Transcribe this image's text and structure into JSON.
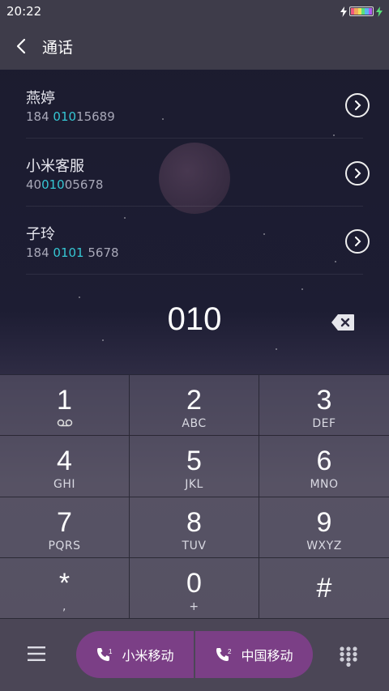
{
  "status_bar": {
    "time": "20:22"
  },
  "header": {
    "title": "通话"
  },
  "contacts": [
    {
      "name": "燕婷",
      "number_pre": "184 ",
      "number_hl": "010",
      "number_post": "15689"
    },
    {
      "name": "小米客服",
      "number_pre": "40",
      "number_hl": "010",
      "number_post": "05678"
    },
    {
      "name": "子玲",
      "number_pre": "184 ",
      "number_hl": "0101",
      "number_post": " 5678"
    }
  ],
  "dialed_number": "010",
  "keypad": [
    {
      "digit": "1",
      "letters": ""
    },
    {
      "digit": "2",
      "letters": "ABC"
    },
    {
      "digit": "3",
      "letters": "DEF"
    },
    {
      "digit": "4",
      "letters": "GHI"
    },
    {
      "digit": "5",
      "letters": "JKL"
    },
    {
      "digit": "6",
      "letters": "MNO"
    },
    {
      "digit": "7",
      "letters": "PQRS"
    },
    {
      "digit": "8",
      "letters": "TUV"
    },
    {
      "digit": "9",
      "letters": "WXYZ"
    },
    {
      "digit": "*",
      "letters": ","
    },
    {
      "digit": "0",
      "letters": "+"
    },
    {
      "digit": "#",
      "letters": ""
    }
  ],
  "call_buttons": [
    {
      "label": "小米移动",
      "sim": "1"
    },
    {
      "label": "中国移动",
      "sim": "2"
    }
  ],
  "colors": {
    "highlight": "#35c6d3",
    "call_button": "#7b3f86",
    "header_bg": "#3e3c4a"
  },
  "icons": [
    "back-icon",
    "chevron-right-icon",
    "backspace-icon",
    "voicemail-icon",
    "menu-icon",
    "phone-icon",
    "dialpad-icon",
    "charging-icon",
    "battery-icon"
  ]
}
